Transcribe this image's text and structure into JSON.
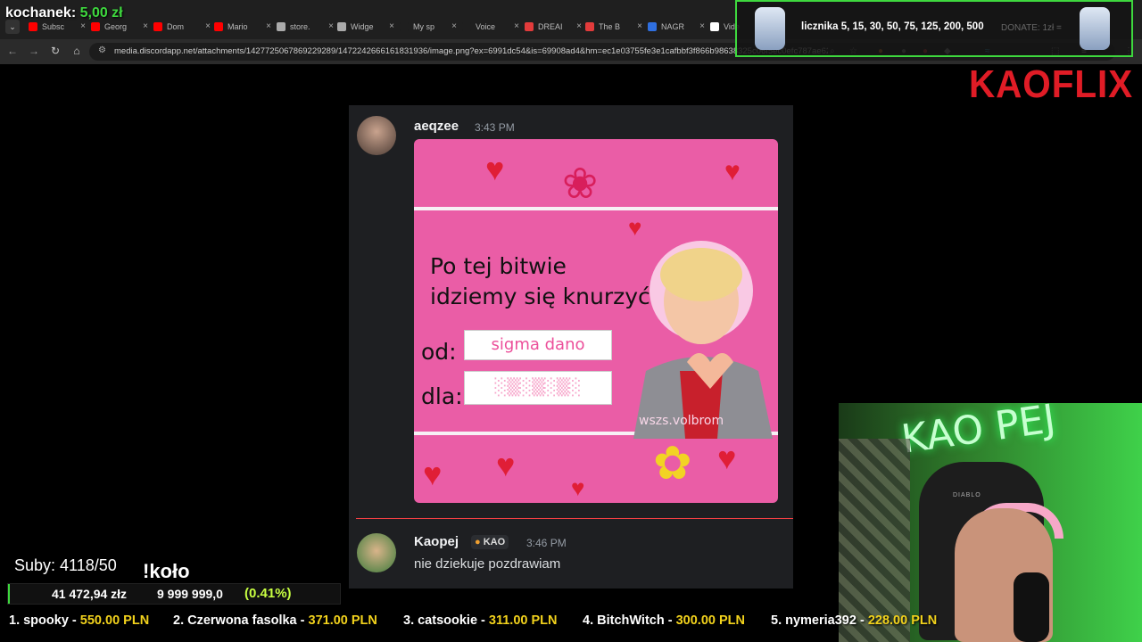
{
  "browser": {
    "tabs": [
      {
        "label": "Subsc",
        "color": "#ff0000"
      },
      {
        "label": "Georg",
        "color": "#ff0000"
      },
      {
        "label": "Dom",
        "color": "#ff0000"
      },
      {
        "label": "Mario",
        "color": "#ff0000"
      },
      {
        "label": "store.",
        "color": "#aaaaaa"
      },
      {
        "label": "Widge",
        "color": "#aaaaaa"
      },
      {
        "label": "My sp",
        "color": "#1f1f1f"
      },
      {
        "label": "Voice",
        "color": "#1f1f1f"
      },
      {
        "label": "DREAI",
        "color": "#e23b3b"
      },
      {
        "label": "The B",
        "color": "#e23b3b"
      },
      {
        "label": "NAGR",
        "color": "#2f6fe0"
      },
      {
        "label": "Vide",
        "color": "#ffffff"
      }
    ],
    "tab_close": "×",
    "url": "media.discordapp.net/attachments/1427725067869229289/1472242666161831936/image.png?ex=6991dc54&is=69908ad4&hm=ec1e03755fe3e1cafbbf3f866b98638325c06f5ec0efc787ae62..."
  },
  "overlay": {
    "kochanek_label": "kochanek:",
    "kochanek_amount": "5,00 zł",
    "donation_text": "licznika 5, 15, 30, 50, 75, 125, 200, 500",
    "donation_ghost": "DONATE: 1zł =",
    "brand": "KAOFLIX"
  },
  "discord": {
    "msg1": {
      "user": "aeqzee",
      "time": "3:43 PM"
    },
    "meme": {
      "line1": "Po tej bitwie",
      "line2": "idziemy się knurzyć",
      "od_label": "od:",
      "od_value": "sigma dano",
      "dla_label": "dla:",
      "dla_value": "░▒░▒░▒░",
      "watermark": "wszs.volbrom"
    },
    "msg2": {
      "user": "Kaopej",
      "badge": "KAO",
      "time": "3:46 PM",
      "text": "nie dziekuje pozdrawiam"
    }
  },
  "webcam": {
    "neon": "KAO PEJ",
    "chair_brand": "DIABLO"
  },
  "stats": {
    "suby": "Suby: 4118/50",
    "kolo": "!koło",
    "goal_current": "41 472,94 złz",
    "goal_target": "9 999 999,0",
    "goal_pct": "(0.41%)",
    "goal_fraction": 0.0041
  },
  "ticker": [
    {
      "name": "1. spooky - ",
      "value": "550.00 PLN"
    },
    {
      "name": "2. Czerwona fasolka - ",
      "value": "371.00 PLN"
    },
    {
      "name": "3. catsookie - ",
      "value": "311.00 PLN"
    },
    {
      "name": "4. BitchWitch - ",
      "value": "300.00 PLN"
    },
    {
      "name": "5. nymeria392 - ",
      "value": "228.00 PLN"
    }
  ]
}
